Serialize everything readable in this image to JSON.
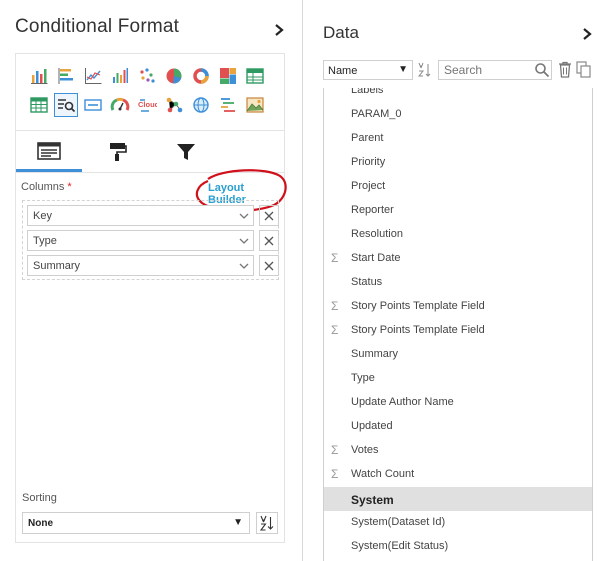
{
  "left_panel": {
    "title": "Conditional Format",
    "columns_label": "Columns",
    "required_marker": "*",
    "layout_builder_label": "Layout Builder",
    "columns": [
      "Key",
      "Type",
      "Summary"
    ],
    "sorting_label": "Sorting",
    "sorting_value": "None",
    "chart_types": [
      "bar-chart-icon",
      "horizontal-bar-icon",
      "line-chart-icon",
      "stacked-bar-icon",
      "scatter-icon",
      "pie-chart-icon",
      "donut-chart-icon",
      "treemap-icon",
      "table-grid-icon",
      "pivot-table-icon",
      "table-search-icon",
      "kpi-card-icon",
      "gauge-icon",
      "word-cloud-icon",
      "network-icon",
      "globe-map-icon",
      "funnel-list-icon",
      "image-chart-icon"
    ],
    "selected_chart_index": 10,
    "word_cloud_text": "Cloud",
    "property_tabs": [
      "layout-tab",
      "style-tab",
      "filter-tab"
    ],
    "active_tab": 0
  },
  "right_panel": {
    "title": "Data",
    "sort_select_value": "Name",
    "search_placeholder": "Search",
    "fields": [
      {
        "label": "Labels",
        "measure": false
      },
      {
        "label": "PARAM_0",
        "measure": false
      },
      {
        "label": "Parent",
        "measure": false
      },
      {
        "label": "Priority",
        "measure": false
      },
      {
        "label": "Project",
        "measure": false
      },
      {
        "label": "Reporter",
        "measure": false
      },
      {
        "label": "Resolution",
        "measure": false
      },
      {
        "label": "Start Date",
        "measure": true
      },
      {
        "label": "Status",
        "measure": false
      },
      {
        "label": "Story Points Template Field",
        "measure": true
      },
      {
        "label": "Story Points Template Field",
        "measure": true
      },
      {
        "label": "Summary",
        "measure": false
      },
      {
        "label": "Type",
        "measure": false
      },
      {
        "label": "Update Author Name",
        "measure": false
      },
      {
        "label": "Updated",
        "measure": false
      },
      {
        "label": "Votes",
        "measure": true
      },
      {
        "label": "Watch Count",
        "measure": true
      },
      {
        "label": "System",
        "measure": false
      },
      {
        "label": "System(Dataset Id)",
        "measure": false
      },
      {
        "label": "System(Edit Status)",
        "measure": false
      }
    ],
    "selected_field_index": 17
  },
  "colors": {
    "accent_blue": "#3d8fd8",
    "link_blue": "#2a9fd0",
    "required_red": "#e02020",
    "annotation_red": "#d0101a",
    "selected_row": "#e0e0e0"
  }
}
